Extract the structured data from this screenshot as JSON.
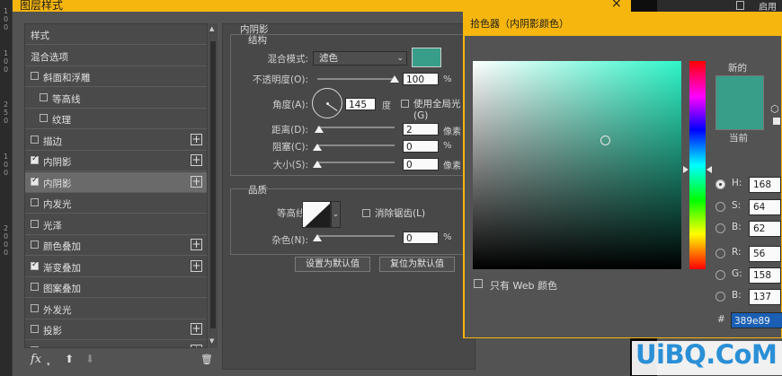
{
  "ruler": {
    "marks": [
      "100",
      "100",
      "250",
      "100",
      "2000"
    ]
  },
  "dialog": {
    "title": "图层样式",
    "close_glyph": "×"
  },
  "style_list": {
    "items": [
      {
        "label": "样式",
        "checkbox": false,
        "checked": false,
        "indent": 0,
        "plus": false,
        "selected": false
      },
      {
        "label": "混合选项",
        "checkbox": false,
        "checked": false,
        "indent": 0,
        "plus": false,
        "selected": false
      },
      {
        "label": "斜面和浮雕",
        "checkbox": true,
        "checked": false,
        "indent": 0,
        "plus": false,
        "selected": false
      },
      {
        "label": "等高线",
        "checkbox": true,
        "checked": false,
        "indent": 1,
        "plus": false,
        "selected": false
      },
      {
        "label": "纹理",
        "checkbox": true,
        "checked": false,
        "indent": 1,
        "plus": false,
        "selected": false
      },
      {
        "label": "描边",
        "checkbox": true,
        "checked": false,
        "indent": 0,
        "plus": true,
        "selected": false
      },
      {
        "label": "内阴影",
        "checkbox": true,
        "checked": true,
        "indent": 0,
        "plus": true,
        "selected": false
      },
      {
        "label": "内阴影",
        "checkbox": true,
        "checked": true,
        "indent": 0,
        "plus": true,
        "selected": true
      },
      {
        "label": "内发光",
        "checkbox": true,
        "checked": false,
        "indent": 0,
        "plus": false,
        "selected": false
      },
      {
        "label": "光泽",
        "checkbox": true,
        "checked": false,
        "indent": 0,
        "plus": false,
        "selected": false
      },
      {
        "label": "颜色叠加",
        "checkbox": true,
        "checked": false,
        "indent": 0,
        "plus": true,
        "selected": false
      },
      {
        "label": "渐变叠加",
        "checkbox": true,
        "checked": true,
        "indent": 0,
        "plus": true,
        "selected": false
      },
      {
        "label": "图案叠加",
        "checkbox": true,
        "checked": false,
        "indent": 0,
        "plus": false,
        "selected": false
      },
      {
        "label": "外发光",
        "checkbox": true,
        "checked": false,
        "indent": 0,
        "plus": false,
        "selected": false
      },
      {
        "label": "投影",
        "checkbox": true,
        "checked": false,
        "indent": 0,
        "plus": true,
        "selected": false
      },
      {
        "label": "投影",
        "checkbox": true,
        "checked": false,
        "indent": 0,
        "plus": true,
        "selected": false
      }
    ],
    "footer": {
      "fx": "fx",
      "fx_caret": "▾",
      "up": "⬆",
      "down": "⬇",
      "trash": "🗑"
    }
  },
  "inner_shadow": {
    "section_title": "内阴影",
    "structure_title": "结构",
    "blend_mode_label": "混合模式:",
    "blend_mode_value": "滤色",
    "opacity_label": "不透明度(O):",
    "opacity_value": "100",
    "opacity_unit": "%",
    "opacity_level": 1.0,
    "angle_label": "角度(A):",
    "angle_value": "145",
    "angle_unit": "度",
    "global_light_label": "使用全局光(G)",
    "global_light_checked": false,
    "distance_label": "距离(D):",
    "distance_value": "2",
    "distance_unit": "像素",
    "distance_level": 0.02,
    "choke_label": "阻塞(C):",
    "choke_value": "0",
    "choke_unit": "%",
    "choke_level": 0,
    "size_label": "大小(S):",
    "size_value": "0",
    "size_unit": "像素",
    "size_level": 0,
    "quality_title": "品质",
    "contour_label": "等高线:",
    "antialias_label": "消除锯齿(L)",
    "antialias_checked": false,
    "noise_label": "杂色(N):",
    "noise_value": "0",
    "noise_unit": "%",
    "noise_level": 0,
    "make_default_label": "设置为默认值",
    "reset_default_label": "复位为默认值",
    "color_hex": "#389e89"
  },
  "background_strip": {
    "enable_label": "启用图"
  },
  "color_picker": {
    "title": "拾色器（内阴影颜色）",
    "new_label": "新的",
    "current_label": "当前",
    "new_color": "#389e89",
    "only_web_label": "只有 Web 颜色",
    "only_web_checked": false,
    "fields": [
      {
        "label": "H:",
        "value": "168",
        "unit": "",
        "selected": true
      },
      {
        "label": "S:",
        "value": "64",
        "unit": "",
        "selected": false
      },
      {
        "label": "B:",
        "value": "62",
        "unit": "",
        "selected": false
      },
      {
        "label": "R:",
        "value": "56",
        "unit": "",
        "selected": false
      },
      {
        "label": "G:",
        "value": "158",
        "unit": "",
        "selected": false
      },
      {
        "label": "B:",
        "value": "137",
        "unit": "",
        "selected": false
      }
    ],
    "hash_label": "#",
    "hex_value": "389e89"
  },
  "watermark": {
    "text": "UiBQ.CoM"
  }
}
